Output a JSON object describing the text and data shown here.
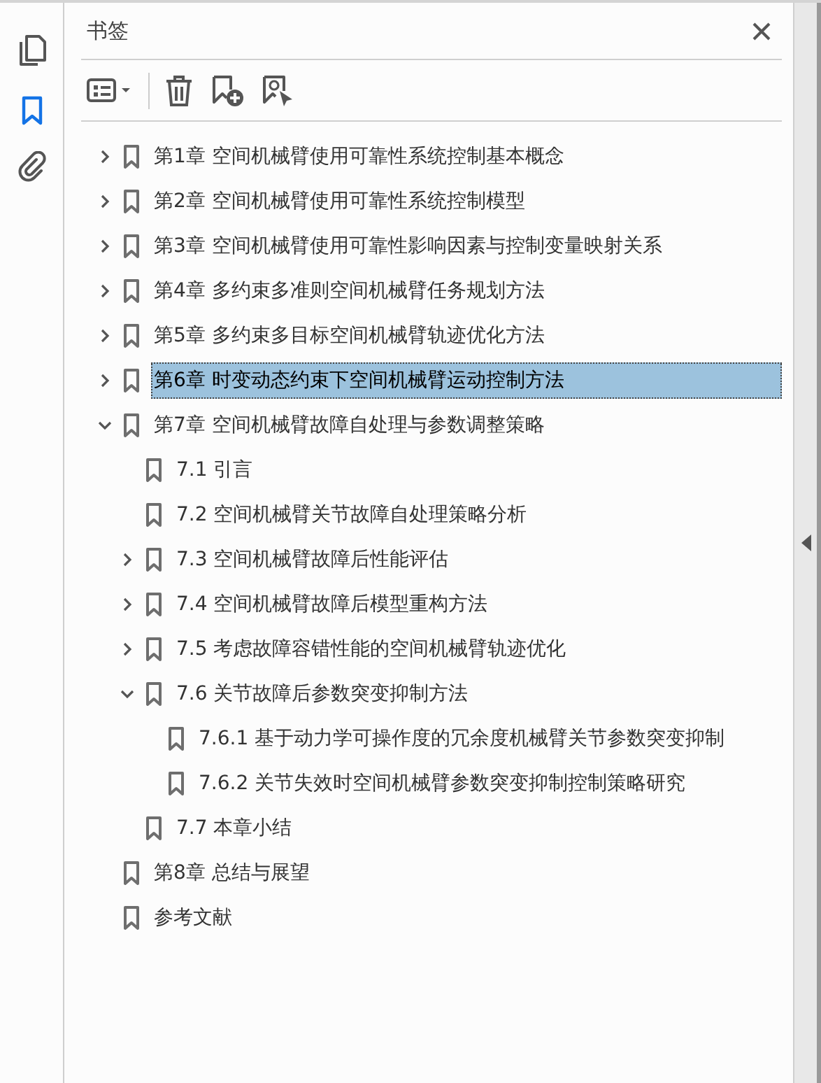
{
  "panel": {
    "title": "书签"
  },
  "bookmarks": [
    {
      "label": "第1章 空间机械臂使用可靠性系统控制基本概念",
      "expanded": false,
      "selected": false
    },
    {
      "label": "第2章 空间机械臂使用可靠性系统控制模型",
      "expanded": false,
      "selected": false
    },
    {
      "label": "第3章 空间机械臂使用可靠性影响因素与控制变量映射关系",
      "expanded": false,
      "selected": false
    },
    {
      "label": "第4章 多约束多准则空间机械臂任务规划方法",
      "expanded": false,
      "selected": false
    },
    {
      "label": "第5章 多约束多目标空间机械臂轨迹优化方法",
      "expanded": false,
      "selected": false
    },
    {
      "label": "第6章 时变动态约束下空间机械臂运动控制方法",
      "expanded": false,
      "selected": true
    },
    {
      "label": "第7章 空间机械臂故障自处理与参数调整策略",
      "expanded": true,
      "selected": false,
      "children": [
        {
          "label": "7.1 引言",
          "selected": false
        },
        {
          "label": "7.2 空间机械臂关节故障自处理策略分析",
          "selected": false
        },
        {
          "label": "7.3 空间机械臂故障后性能评估",
          "expanded": false,
          "selected": false
        },
        {
          "label": "7.4 空间机械臂故障后模型重构方法",
          "expanded": false,
          "selected": false
        },
        {
          "label": "7.5 考虑故障容错性能的空间机械臂轨迹优化",
          "expanded": false,
          "selected": false
        },
        {
          "label": "7.6 关节故障后参数突变抑制方法",
          "expanded": true,
          "selected": false,
          "children": [
            {
              "label": "7.6.1 基于动力学可操作度的冗余度机械臂关节参数突变抑制",
              "selected": false
            },
            {
              "label": "7.6.2 关节失效时空间机械臂参数突变抑制控制策略研究",
              "selected": false
            }
          ]
        },
        {
          "label": "7.7 本章小结",
          "selected": false
        }
      ]
    },
    {
      "label": "第8章 总结与展望",
      "selected": false
    },
    {
      "label": "参考文献",
      "selected": false
    }
  ]
}
